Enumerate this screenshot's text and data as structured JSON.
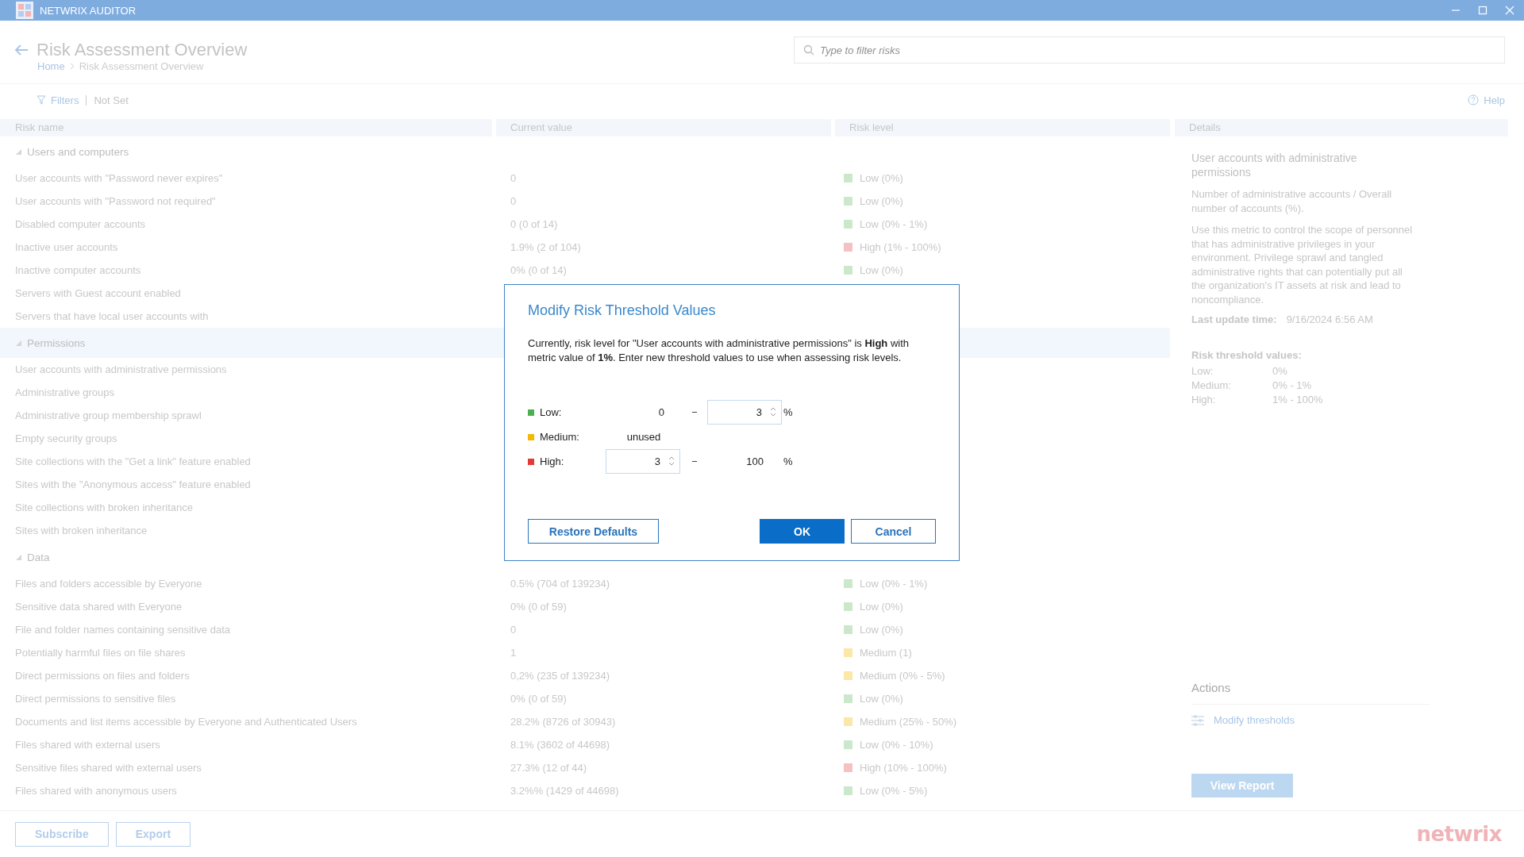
{
  "window": {
    "title": "NETWRIX AUDITOR"
  },
  "page": {
    "title": "Risk Assessment Overview",
    "breadcrumb": [
      "Home",
      "Risk Assessment Overview"
    ],
    "search": {
      "placeholder": "Type to filter risks"
    },
    "filters": {
      "label": "Filters",
      "value": "Not Set"
    },
    "help": "Help"
  },
  "table": {
    "columns": [
      "Risk name",
      "Current value",
      "Risk level"
    ],
    "groups": [
      {
        "name": "Users and computers",
        "expanded": true,
        "selected": false,
        "rows": [
          {
            "name": "User accounts with \"Password never expires\"",
            "value": "0",
            "level": "Low (0%)",
            "color": "#cbe8cb"
          },
          {
            "name": "User accounts with \"Password not required\"",
            "value": "0",
            "level": "Low (0%)",
            "color": "#cbe8cb"
          },
          {
            "name": "Disabled computer accounts",
            "value": "0 (0 of 14)",
            "level": "Low (0% - 1%)",
            "color": "#cbe8cb"
          },
          {
            "name": "Inactive user accounts",
            "value": "1.9% (2 of 104)",
            "level": "High (1% - 100%)",
            "color": "#f5c2c2"
          },
          {
            "name": "Inactive computer accounts",
            "value": "0% (0 of 14)",
            "level": "Low (0%)",
            "color": "#cbe8cb"
          },
          {
            "name": "Servers with Guest account enabled"
          },
          {
            "name": "Servers that have local user accounts with"
          }
        ]
      },
      {
        "name": "Permissions",
        "expanded": true,
        "selected": true,
        "rows": [
          {
            "name": "User accounts with administrative permissions"
          },
          {
            "name": "Administrative groups"
          },
          {
            "name": "Administrative group membership sprawl"
          },
          {
            "name": "Empty security groups"
          },
          {
            "name": "Site collections with the \"Get a link\" feature enabled"
          },
          {
            "name": "Sites with the \"Anonymous access\" feature enabled"
          },
          {
            "name": "Site collections with broken inheritance"
          },
          {
            "name": "Sites with broken inheritance"
          }
        ]
      },
      {
        "name": "Data",
        "expanded": true,
        "selected": false,
        "rows": [
          {
            "name": "Files and folders accessible by Everyone",
            "value": "0.5% (704 of 139234)",
            "level": "Low (0% - 1%)",
            "color": "#cbe8cb"
          },
          {
            "name": "Sensitive data shared with Everyone",
            "value": "0% (0 of 59)",
            "level": "Low (0%)",
            "color": "#cbe8cb"
          },
          {
            "name": "File and folder names containing sensitive data",
            "value": "0",
            "level": "Low (0%)",
            "color": "#cbe8cb"
          },
          {
            "name": "Potentially harmful files on file shares",
            "value": "1",
            "level": "Medium (1)",
            "color": "#fbe7a8"
          },
          {
            "name": "Direct permissions on files and folders",
            "value": "0,2% (235 of 139234)",
            "level": "Medium (0% - 5%)",
            "color": "#fbe7a8"
          },
          {
            "name": "Direct permissions to sensitive files",
            "value": "0% (0 of 59)",
            "level": "Low (0%)",
            "color": "#cbe8cb"
          },
          {
            "name": "Documents and list items accessible by Everyone and Authenticated Users",
            "value": "28.2% (8726 of 30943)",
            "level": "Medium (25% - 50%)",
            "color": "#fbe7a8"
          },
          {
            "name": "Files shared with external users",
            "value": "8.1% (3602 of 44698)",
            "level": "Low (0% - 10%)",
            "color": "#cbe8cb"
          },
          {
            "name": "Sensitive files shared with external users",
            "value": "27.3% (12 of 44)",
            "level": "High (10% - 100%)",
            "color": "#f5c2c2"
          },
          {
            "name": "Files shared with anonymous users",
            "value": "3.2%% (1429 of 44698)",
            "level": "Low (0% - 5%)",
            "color": "#cbe8cb"
          }
        ]
      }
    ]
  },
  "details": {
    "header": "Details",
    "title": "User accounts with administrative permissions",
    "formula": "Number of administrative accounts / Overall number of accounts (%).",
    "description": "Use this metric to control the scope of personnel that has administrative privileges in your environment. Privilege sprawl and tangled administrative rights that can potentially put all the organization's IT assets at risk and lead to noncompliance.",
    "last_update_label": "Last update time:",
    "last_update_value": "9/16/2024 6:56 AM",
    "thresholds_title": "Risk threshold values:",
    "thresholds": [
      {
        "label": "Low:",
        "value": "0%"
      },
      {
        "label": "Medium:",
        "value": "0% - 1%"
      },
      {
        "label": "High:",
        "value": "1% - 100%"
      }
    ],
    "actions_title": "Actions",
    "action": "Modify thresholds",
    "view_report": "View Report"
  },
  "footer": {
    "buttons": [
      "Subscribe",
      "Export"
    ],
    "logo": "netwrix"
  },
  "dialog": {
    "title": "Modify Risk Threshold Values",
    "message": "Currently, risk level for \"User accounts with administrative permissions\" is **High** with metric value of **1%**. Enter new threshold values to use when assessing risk levels.",
    "thresholds": [
      {
        "kind": "range_to",
        "label": "Low:",
        "color": "#4caf50",
        "from": "0",
        "to": "3",
        "unit": "%"
      },
      {
        "kind": "unused",
        "label": "Medium:",
        "color": "#f5b800",
        "text": "unused"
      },
      {
        "kind": "range_from",
        "label": "High:",
        "color": "#e53935",
        "from": "3",
        "to": "100",
        "unit": "%"
      }
    ],
    "buttons": [
      {
        "kind": "secondary",
        "label": "Restore Defaults"
      },
      {
        "kind": "primary",
        "label": "OK"
      },
      {
        "kind": "secondary",
        "label": "Cancel"
      }
    ]
  }
}
